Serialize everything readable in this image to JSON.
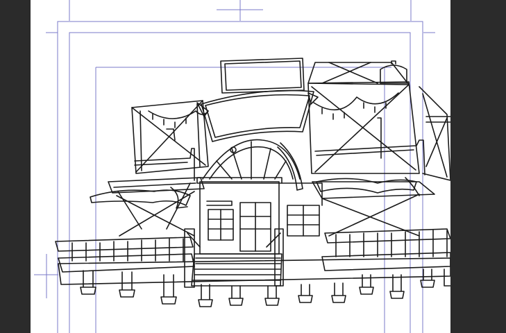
{
  "app": {
    "document_type": "manga-panel-canvas",
    "tool_mode": "line-art"
  },
  "colors": {
    "workspace_background": "#2b2b2b",
    "canvas_background": "#ffffff",
    "guide_lines": "#7a78c8",
    "line_art": "#1a1a1a"
  },
  "canvas": {
    "icons": [
      "crop-mark-top",
      "crop-mark-left"
    ]
  }
}
